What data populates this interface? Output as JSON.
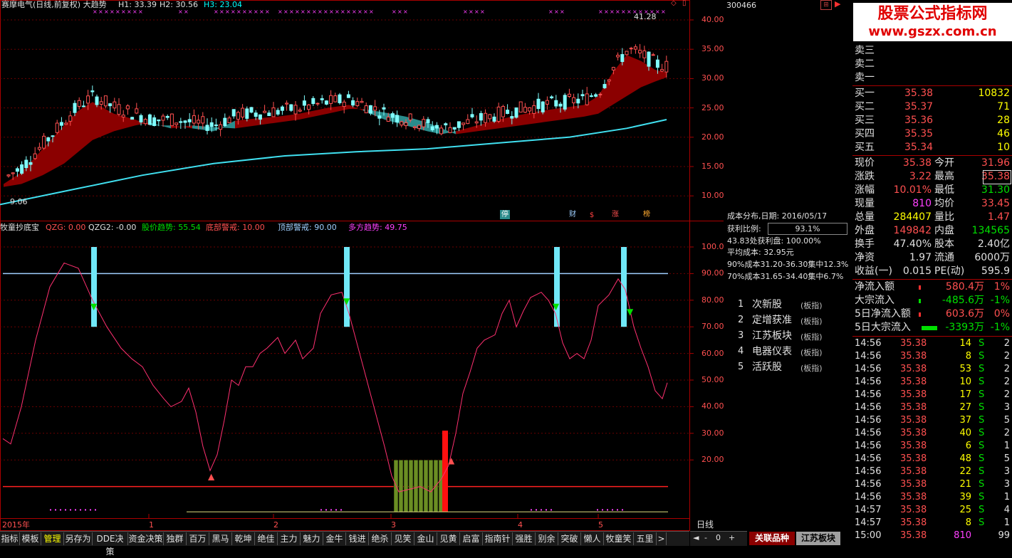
{
  "main_chart": {
    "title": "赛摩电气(日线,前复权) 大趋势",
    "h1": "H1: 33.39",
    "h2": "H2: 30.56",
    "h3": "H3: 23.04",
    "high_label": "41.28",
    "low_label": "9.06",
    "y_ticks": [
      "40.00",
      "35.00",
      "30.00",
      "25.00",
      "20.00",
      "15.00",
      "10.00"
    ],
    "event_markers": [
      "停",
      "财",
      "$",
      "涨",
      "榜"
    ],
    "colors": {
      "ribbon_up": "#8b0000",
      "ribbon_down": "#2a8c8c",
      "ma": "#40e0f0",
      "candle_up": "#ff5050",
      "candle_down": "#80ffff"
    }
  },
  "sub_chart": {
    "name": "牧童抄底宝",
    "qzg": "QZG: 0.00",
    "qzg2": "QZG2: -0.00",
    "trend": "股价趋势: 55.54",
    "bottom_warn": "底部警戒: 10.00",
    "top_warn": "顶部警戒: 90.00",
    "multi_trend": "多方趋势: 49.75",
    "y_ticks": [
      "100.0",
      "90.00",
      "80.00",
      "70.00",
      "60.00",
      "50.00",
      "40.00",
      "30.00",
      "20.00"
    ]
  },
  "x_axis": {
    "labels": [
      "2015年",
      "1",
      "2",
      "3",
      "4",
      "5"
    ],
    "period": "日线"
  },
  "cost": {
    "header": "成本分布,日期: 2016/05/17",
    "profit_label": "获利比例:",
    "profit_value": "93.1%",
    "line1": "43.83处获利盘: 100.00%",
    "line2": "平均成本: 32.95元",
    "line3": "90%成本31.20-36.30集中12.3%",
    "line4": "70%成本31.65-34.40集中6.7%",
    "y_labels": [
      "40.00",
      "35.00",
      "30.00",
      "25.00",
      "20.00",
      "15.00",
      "10.00"
    ]
  },
  "related": [
    {
      "num": "1",
      "name": "次新股",
      "tag": "(板指)"
    },
    {
      "num": "2",
      "name": "定增获准",
      "tag": "(板指)"
    },
    {
      "num": "3",
      "name": "江苏板块",
      "tag": "(板指)"
    },
    {
      "num": "4",
      "name": "电器仪表",
      "tag": "(板指)"
    },
    {
      "num": "5",
      "name": "活跃股",
      "tag": "(板指)"
    }
  ],
  "quote": {
    "code": "300466",
    "watermark_title": "股票公式指标网",
    "watermark_url": "www.gszx.com.cn",
    "sell": [
      {
        "label": "卖三"
      },
      {
        "label": "卖二"
      },
      {
        "label": "卖一"
      }
    ],
    "buy": [
      {
        "label": "买一",
        "price": "35.38",
        "vol": "10832"
      },
      {
        "label": "买二",
        "price": "35.37",
        "vol": "71"
      },
      {
        "label": "买三",
        "price": "35.36",
        "vol": "28"
      },
      {
        "label": "买四",
        "price": "35.35",
        "vol": "46"
      },
      {
        "label": "买五",
        "price": "35.34",
        "vol": "10"
      }
    ],
    "stats": [
      {
        "l1": "现价",
        "v1": "35.38",
        "l2": "今开",
        "v2": "31.96"
      },
      {
        "l1": "涨跌",
        "v1": "3.22",
        "l2": "最高",
        "v2": "35.38"
      },
      {
        "l1": "涨幅",
        "v1": "10.01%",
        "l2": "最低",
        "v2": "31.30"
      },
      {
        "l1": "现量",
        "v1": "810",
        "l2": "均价",
        "v2": "33.45"
      },
      {
        "l1": "总量",
        "v1": "284407",
        "l2": "量比",
        "v2": "1.47"
      },
      {
        "l1": "外盘",
        "v1": "149842",
        "l2": "内盘",
        "v2": "134565"
      },
      {
        "l1": "换手",
        "v1": "47.40%",
        "l2": "股本",
        "v2": "2.40亿"
      },
      {
        "l1": "净资",
        "v1": "1.97",
        "l2": "流通",
        "v2": "6000万"
      },
      {
        "l1": "收益(一)",
        "v1": "0.015",
        "l2": "PE(动)",
        "v2": "595.9"
      }
    ],
    "flows": [
      {
        "label": "净流入额",
        "value": "580.4万",
        "pct": "1%"
      },
      {
        "label": "大宗流入",
        "value": "-485.6万",
        "pct": "-1%"
      },
      {
        "label": "5日净流入额",
        "value": "603.6万",
        "pct": "0%"
      },
      {
        "label": "5日大宗流入",
        "value": "-3393万",
        "pct": "-1%"
      }
    ],
    "trades": [
      {
        "time": "14:56",
        "price": "35.38",
        "vol": "14",
        "bs": "S",
        "n": "2"
      },
      {
        "time": "14:56",
        "price": "35.38",
        "vol": "8",
        "bs": "S",
        "n": "2"
      },
      {
        "time": "14:56",
        "price": "35.38",
        "vol": "53",
        "bs": "S",
        "n": "2"
      },
      {
        "time": "14:56",
        "price": "35.38",
        "vol": "10",
        "bs": "S",
        "n": "2"
      },
      {
        "time": "14:56",
        "price": "35.38",
        "vol": "17",
        "bs": "S",
        "n": "2"
      },
      {
        "time": "14:56",
        "price": "35.38",
        "vol": "27",
        "bs": "S",
        "n": "3"
      },
      {
        "time": "14:56",
        "price": "35.38",
        "vol": "37",
        "bs": "S",
        "n": "5"
      },
      {
        "time": "14:56",
        "price": "35.38",
        "vol": "40",
        "bs": "S",
        "n": "2"
      },
      {
        "time": "14:56",
        "price": "35.38",
        "vol": "6",
        "bs": "S",
        "n": "1"
      },
      {
        "time": "14:56",
        "price": "35.38",
        "vol": "48",
        "bs": "S",
        "n": "5"
      },
      {
        "time": "14:56",
        "price": "35.38",
        "vol": "22",
        "bs": "S",
        "n": "3"
      },
      {
        "time": "14:56",
        "price": "35.38",
        "vol": "21",
        "bs": "S",
        "n": "3"
      },
      {
        "time": "14:56",
        "price": "35.38",
        "vol": "39",
        "bs": "S",
        "n": "1"
      },
      {
        "time": "14:57",
        "price": "35.38",
        "vol": "25",
        "bs": "S",
        "n": "4"
      },
      {
        "time": "14:57",
        "price": "35.38",
        "vol": "8",
        "bs": "S",
        "n": "1"
      },
      {
        "time": "15:00",
        "price": "35.38",
        "vol": "810",
        "bs": "",
        "n": "99"
      }
    ]
  },
  "bottom_tabs": [
    "指标",
    "模板",
    "管理",
    "另存为",
    "DDE决策",
    "资金决策",
    "独群",
    "百万",
    "黑马",
    "乾坤",
    "绝佳",
    "主力",
    "魅力",
    "金牛",
    "钱进",
    "绝杀",
    "见笑",
    "金山",
    "见黄",
    "启富",
    "指南针",
    "强胜",
    "别余",
    "突破",
    "懒人",
    "牧童笑",
    "五里",
    ">"
  ],
  "right_tabs": [
    "关联品种",
    "江苏板块"
  ],
  "nav": [
    "◄",
    "-",
    "0",
    "+"
  ]
}
